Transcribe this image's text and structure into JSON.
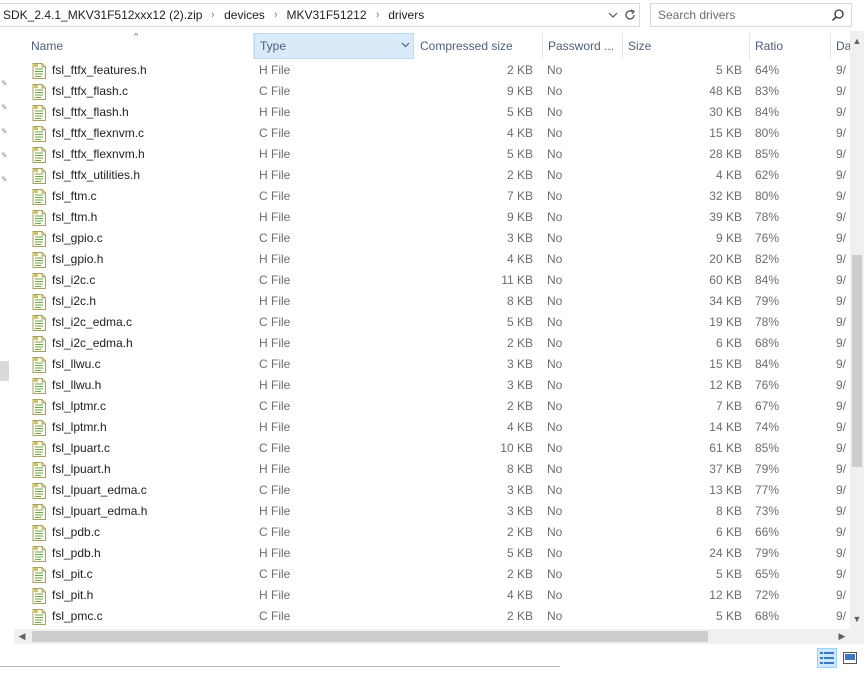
{
  "address": {
    "crumbs": [
      "SDK_2.4.1_MKV31F512xxx12 (2).zip",
      "devices",
      "MKV31F51212",
      "drivers"
    ],
    "separator": "›"
  },
  "search": {
    "placeholder": "Search drivers"
  },
  "columns": {
    "name": "Name",
    "type": "Type",
    "compressed": "Compressed size",
    "password": "Password ...",
    "size": "Size",
    "ratio": "Ratio",
    "date": "Da"
  },
  "files": [
    {
      "name": "fsl_ftfx_features.h",
      "type": "H File",
      "compressed": "2 KB",
      "password": "No",
      "size": "5 KB",
      "ratio": "64%",
      "date": "9/"
    },
    {
      "name": "fsl_ftfx_flash.c",
      "type": "C File",
      "compressed": "9 KB",
      "password": "No",
      "size": "48 KB",
      "ratio": "83%",
      "date": "9/"
    },
    {
      "name": "fsl_ftfx_flash.h",
      "type": "H File",
      "compressed": "5 KB",
      "password": "No",
      "size": "30 KB",
      "ratio": "84%",
      "date": "9/"
    },
    {
      "name": "fsl_ftfx_flexnvm.c",
      "type": "C File",
      "compressed": "4 KB",
      "password": "No",
      "size": "15 KB",
      "ratio": "80%",
      "date": "9/"
    },
    {
      "name": "fsl_ftfx_flexnvm.h",
      "type": "H File",
      "compressed": "5 KB",
      "password": "No",
      "size": "28 KB",
      "ratio": "85%",
      "date": "9/"
    },
    {
      "name": "fsl_ftfx_utilities.h",
      "type": "H File",
      "compressed": "2 KB",
      "password": "No",
      "size": "4 KB",
      "ratio": "62%",
      "date": "9/"
    },
    {
      "name": "fsl_ftm.c",
      "type": "C File",
      "compressed": "7 KB",
      "password": "No",
      "size": "32 KB",
      "ratio": "80%",
      "date": "9/"
    },
    {
      "name": "fsl_ftm.h",
      "type": "H File",
      "compressed": "9 KB",
      "password": "No",
      "size": "39 KB",
      "ratio": "78%",
      "date": "9/"
    },
    {
      "name": "fsl_gpio.c",
      "type": "C File",
      "compressed": "3 KB",
      "password": "No",
      "size": "9 KB",
      "ratio": "76%",
      "date": "9/"
    },
    {
      "name": "fsl_gpio.h",
      "type": "H File",
      "compressed": "4 KB",
      "password": "No",
      "size": "20 KB",
      "ratio": "82%",
      "date": "9/"
    },
    {
      "name": "fsl_i2c.c",
      "type": "C File",
      "compressed": "11 KB",
      "password": "No",
      "size": "60 KB",
      "ratio": "84%",
      "date": "9/"
    },
    {
      "name": "fsl_i2c.h",
      "type": "H File",
      "compressed": "8 KB",
      "password": "No",
      "size": "34 KB",
      "ratio": "79%",
      "date": "9/"
    },
    {
      "name": "fsl_i2c_edma.c",
      "type": "C File",
      "compressed": "5 KB",
      "password": "No",
      "size": "19 KB",
      "ratio": "78%",
      "date": "9/"
    },
    {
      "name": "fsl_i2c_edma.h",
      "type": "H File",
      "compressed": "2 KB",
      "password": "No",
      "size": "6 KB",
      "ratio": "68%",
      "date": "9/"
    },
    {
      "name": "fsl_llwu.c",
      "type": "C File",
      "compressed": "3 KB",
      "password": "No",
      "size": "15 KB",
      "ratio": "84%",
      "date": "9/"
    },
    {
      "name": "fsl_llwu.h",
      "type": "H File",
      "compressed": "3 KB",
      "password": "No",
      "size": "12 KB",
      "ratio": "76%",
      "date": "9/"
    },
    {
      "name": "fsl_lptmr.c",
      "type": "C File",
      "compressed": "2 KB",
      "password": "No",
      "size": "7 KB",
      "ratio": "67%",
      "date": "9/"
    },
    {
      "name": "fsl_lptmr.h",
      "type": "H File",
      "compressed": "4 KB",
      "password": "No",
      "size": "14 KB",
      "ratio": "74%",
      "date": "9/"
    },
    {
      "name": "fsl_lpuart.c",
      "type": "C File",
      "compressed": "10 KB",
      "password": "No",
      "size": "61 KB",
      "ratio": "85%",
      "date": "9/"
    },
    {
      "name": "fsl_lpuart.h",
      "type": "H File",
      "compressed": "8 KB",
      "password": "No",
      "size": "37 KB",
      "ratio": "79%",
      "date": "9/"
    },
    {
      "name": "fsl_lpuart_edma.c",
      "type": "C File",
      "compressed": "3 KB",
      "password": "No",
      "size": "13 KB",
      "ratio": "77%",
      "date": "9/"
    },
    {
      "name": "fsl_lpuart_edma.h",
      "type": "H File",
      "compressed": "3 KB",
      "password": "No",
      "size": "8 KB",
      "ratio": "73%",
      "date": "9/"
    },
    {
      "name": "fsl_pdb.c",
      "type": "C File",
      "compressed": "2 KB",
      "password": "No",
      "size": "6 KB",
      "ratio": "66%",
      "date": "9/"
    },
    {
      "name": "fsl_pdb.h",
      "type": "H File",
      "compressed": "5 KB",
      "password": "No",
      "size": "24 KB",
      "ratio": "79%",
      "date": "9/"
    },
    {
      "name": "fsl_pit.c",
      "type": "C File",
      "compressed": "2 KB",
      "password": "No",
      "size": "5 KB",
      "ratio": "65%",
      "date": "9/"
    },
    {
      "name": "fsl_pit.h",
      "type": "H File",
      "compressed": "4 KB",
      "password": "No",
      "size": "12 KB",
      "ratio": "72%",
      "date": "9/"
    },
    {
      "name": "fsl_pmc.c",
      "type": "C File",
      "compressed": "2 KB",
      "password": "No",
      "size": "5 KB",
      "ratio": "68%",
      "date": "9/"
    }
  ],
  "icons": {
    "file": "text-file-icon",
    "search": "search-icon",
    "refresh": "refresh-icon",
    "dropdown": "chevron-down-icon"
  },
  "colors": {
    "header_text": "#4c607a",
    "active_header_bg": "#d9ebf9",
    "cell_text": "#6d6d6d"
  }
}
